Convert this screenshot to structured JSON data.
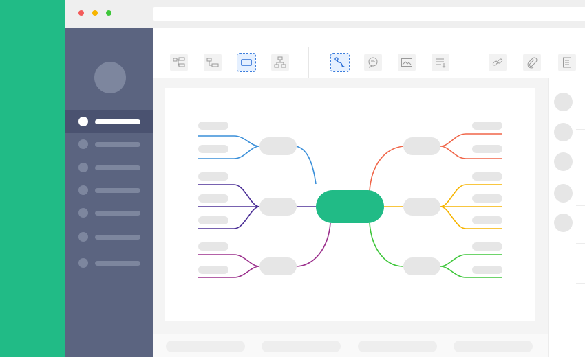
{
  "window": {
    "traffic_lights": [
      "#f35b5a",
      "#f7b500",
      "#3ec63a"
    ],
    "url": ""
  },
  "sidebar": {
    "items": [
      {
        "label": "",
        "active": true
      },
      {
        "label": "",
        "active": false
      },
      {
        "label": "",
        "active": false
      },
      {
        "label": "",
        "active": false
      },
      {
        "label": "",
        "active": false
      },
      {
        "label": "",
        "active": false
      },
      {
        "label": "",
        "active": false
      }
    ]
  },
  "toolbar": {
    "groups": [
      [
        "layout-tree-icon",
        "layout-org-icon",
        "node-shape-icon",
        "layout-hierarchy-icon"
      ],
      [
        "connector-icon",
        "comment-icon",
        "image-icon",
        "note-icon"
      ],
      [
        "link-icon",
        "attachment-icon",
        "document-icon"
      ]
    ],
    "selected": [
      "node-shape-icon",
      "connector-icon"
    ]
  },
  "mindmap": {
    "central_topic": {
      "label": "",
      "color": "#21bb86"
    },
    "branches": [
      {
        "side": "left",
        "color": "#3a8fd9",
        "leaves": 2
      },
      {
        "side": "left",
        "color": "#4b2f96",
        "leaves": 3
      },
      {
        "side": "left",
        "color": "#9b2f8c",
        "leaves": 2
      },
      {
        "side": "right",
        "color": "#f06548",
        "leaves": 2
      },
      {
        "side": "right",
        "color": "#f6b400",
        "leaves": 3
      },
      {
        "side": "right",
        "color": "#3ec63a",
        "leaves": 2
      }
    ]
  },
  "colors": {
    "brand_green": "#21bb86",
    "sidebar_bg": "#5b6480",
    "placeholder": "#e6e6e6"
  }
}
